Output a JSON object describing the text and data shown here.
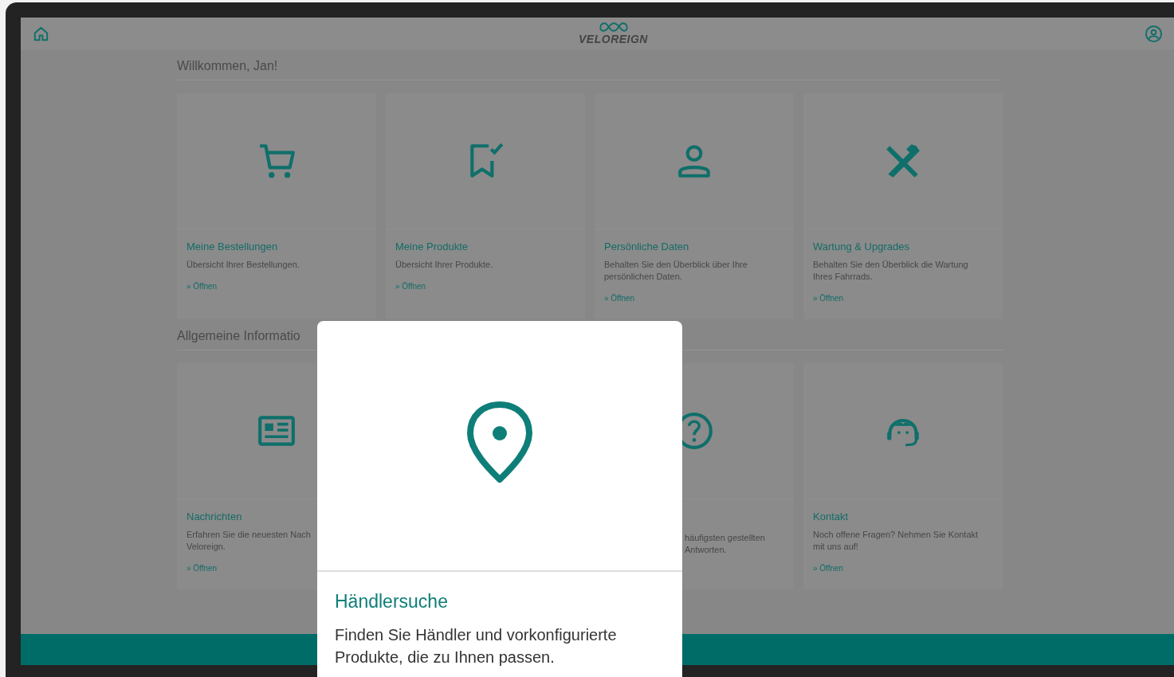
{
  "header": {
    "logo": "VELOREIGN"
  },
  "welcome": {
    "title": "Willkommen, Jan!",
    "cards": [
      {
        "title": "Meine Bestellungen",
        "lines": [
          "Übersicht Ihrer Bestellungen."
        ],
        "link": "» Öffnen"
      },
      {
        "title": "Meine Produkte",
        "lines": [
          "Übersicht Ihrer Produkte."
        ],
        "link": "» Öffnen"
      },
      {
        "title": "Persönliche Daten",
        "lines": [
          "Behalten Sie den Überblick über Ihre",
          "persönlichen Daten."
        ],
        "link": "» Öffnen"
      },
      {
        "title": "Wartung & Upgrades",
        "lines": [
          "Behalten Sie den Überblick die Wartung",
          "Ihres Fahrrads."
        ],
        "link": "» Öffnen"
      }
    ]
  },
  "info": {
    "title": "Allgemeine Informatio",
    "cards": [
      {
        "kind": "full",
        "title": "Nachrichten",
        "lines": [
          "Erfahren Sie die neuesten Nach",
          "Veloreign."
        ],
        "link": "» Öffnen"
      },
      {
        "kind": "covered"
      },
      {
        "kind": "partial",
        "lines": [
          "häufigsten gestellten",
          "Antworten."
        ]
      },
      {
        "kind": "full",
        "title": "Kontakt",
        "lines": [
          "Noch offene Fragen? Nehmen Sie Kontakt",
          "mit uns auf!"
        ],
        "link": "» Öffnen"
      }
    ]
  },
  "modal": {
    "title": "Händlersuche",
    "text": "Finden Sie Händler und vorkonfigurierte Produkte, die zu Ihnen passen."
  }
}
